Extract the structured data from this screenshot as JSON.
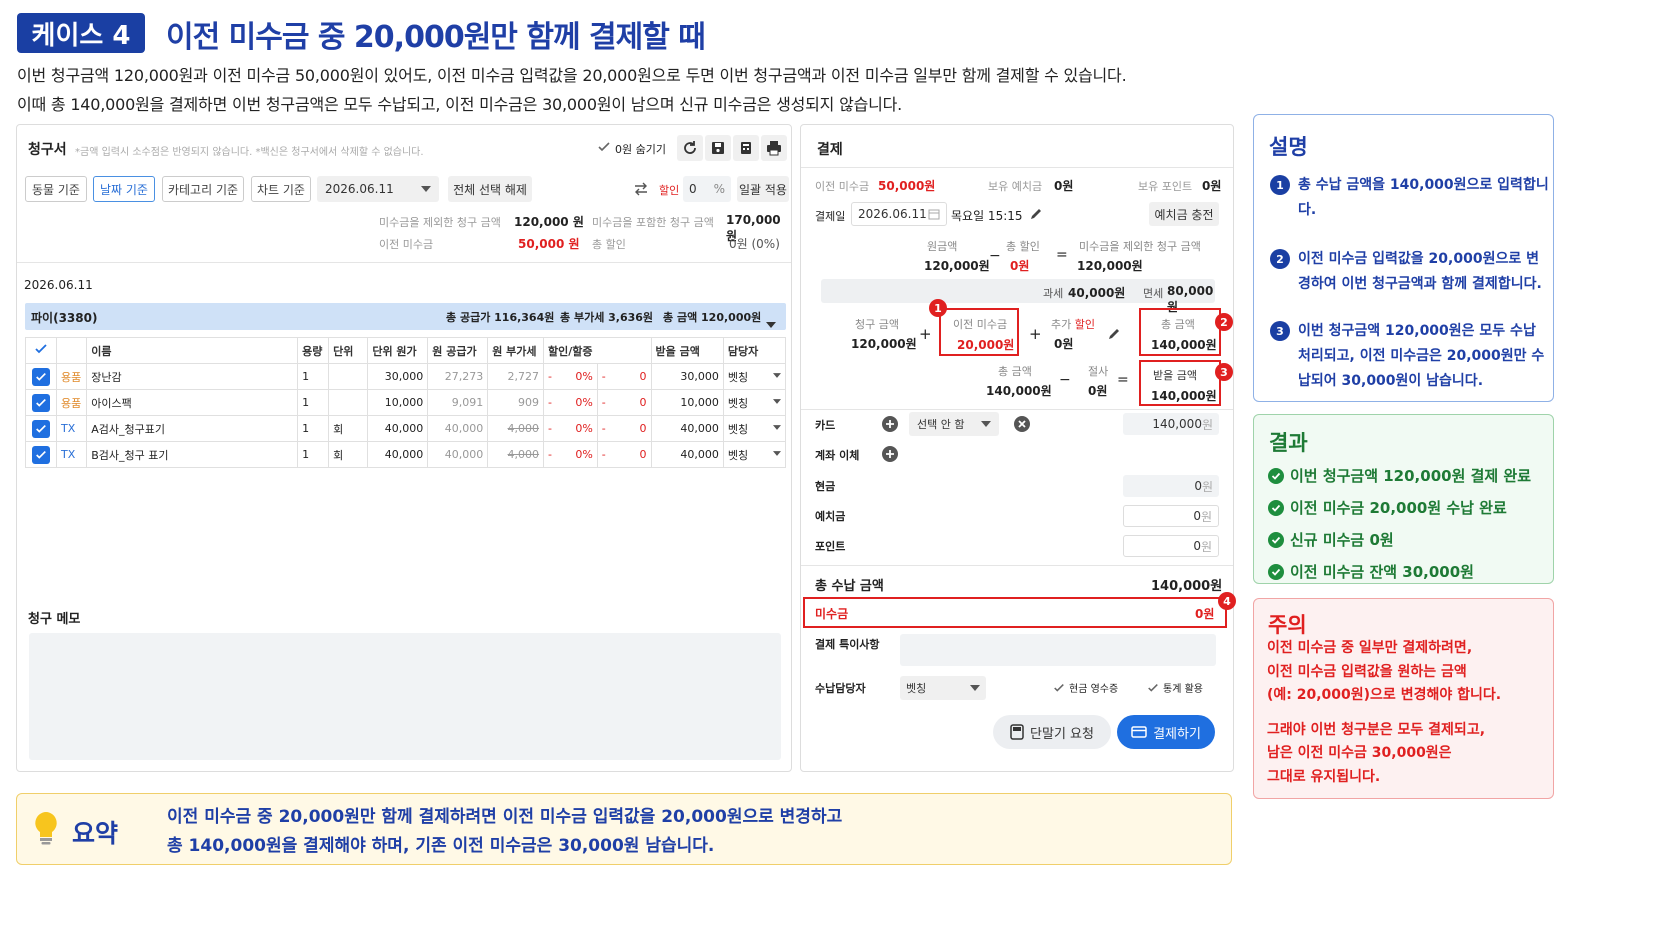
{
  "header": {
    "badge": "케이스 4",
    "title": "이전 미수금 중 20,000원만 함께 결제할 때",
    "line1": "이번 청구금액 120,000원과 이전 미수금 50,000원이 있어도, 이전 미수금 입력값을 20,000원으로 두면 이번 청구금액과 이전 미수금 일부만 함께 결제할 수 있습니다.",
    "line2": "이때 총 140,000원을 결제하면 이번 청구금액은 모두 수납되고, 이전 미수금은 30,000원이 남으며 신규 미수금은 생성되지 않습니다."
  },
  "invoice": {
    "title": "청구서",
    "note": "*금액 입력시 소수점은 반영되지 않습니다. *백신은 청구서에서 삭제할 수 없습니다.",
    "hide_zero": "0원 숨기기",
    "filters": [
      "동물 기준",
      "날짜 기준",
      "카테고리 기준",
      "차트 기준"
    ],
    "date": "2026.06.11",
    "deselect_all": "전체 선택 해제",
    "discount_label": "할인",
    "discount_value": "0",
    "discount_unit": "%",
    "apply_all": "일괄 적용",
    "excl_label": "미수금을 제외한 청구 금액",
    "excl_value": "120,000 원",
    "incl_label": "미수금을 포함한 청구 금액",
    "incl_value": "170,000원",
    "prev_label": "이전 미수금",
    "prev_value": "50,000 원",
    "totdisc_label": "총 할인",
    "totdisc_value": "0원 (0%)",
    "group_date": "2026.06.11",
    "group_name": "파이(3380)",
    "group_supply": "총 공급가 116,364원",
    "group_vat": "총 부가세 3,636원",
    "group_total": "총 금액 120,000원",
    "columns": [
      "이름",
      "용량",
      "단위",
      "단위 원가",
      "원 공급가",
      "원 부가세",
      "할인/할증",
      "받을 금액",
      "담당자"
    ],
    "rows": [
      {
        "type": "용품",
        "name": "장난감",
        "qty": "1",
        "unit": "",
        "cost": "30,000",
        "supply": "27,273",
        "vat": "2,727",
        "dash1": "-",
        "pct": "0%",
        "dash2": "-",
        "disc": "0",
        "amount": "30,000",
        "staff": "벳칭"
      },
      {
        "type": "용품",
        "name": "아이스팩",
        "qty": "1",
        "unit": "",
        "cost": "10,000",
        "supply": "9,091",
        "vat": "909",
        "dash1": "-",
        "pct": "0%",
        "dash2": "-",
        "disc": "0",
        "amount": "10,000",
        "staff": "벳칭"
      },
      {
        "type": "TX",
        "name": "A검사_청구표기",
        "qty": "1",
        "unit": "회",
        "cost": "40,000",
        "supply": "40,000",
        "vat": "4,000",
        "dash1": "-",
        "pct": "0%",
        "dash2": "-",
        "disc": "0",
        "amount": "40,000",
        "staff": "벳칭"
      },
      {
        "type": "TX",
        "name": "B검사_청구 표기",
        "qty": "1",
        "unit": "회",
        "cost": "40,000",
        "supply": "40,000",
        "vat": "4,000",
        "dash1": "-",
        "pct": "0%",
        "dash2": "-",
        "disc": "0",
        "amount": "40,000",
        "staff": "벳칭"
      }
    ],
    "memo_label": "청구 메모"
  },
  "payment": {
    "title": "결제",
    "prev_label": "이전 미수금",
    "prev_value": "50,000원",
    "deposit_label": "보유 예치금",
    "deposit_value": "0원",
    "points_label": "보유 포인트",
    "points_value": "0원",
    "date_label": "결제일",
    "date_value": "2026.06.11",
    "time_value": "목요일 15:15",
    "charge_btn": "예치금 충전",
    "base_label": "원금액",
    "base_value": "120,000원",
    "disc_label": "총 할인",
    "disc_value": "0원",
    "excl_label": "미수금을 제외한 청구 금액",
    "excl_value": "120,000원",
    "tax_label": "과세",
    "tax_value": "40,000원",
    "free_label": "면세",
    "free_value": "80,000원",
    "bill_label": "청구 금액",
    "bill_value": "120,000원",
    "prev2_label": "이전 미수금",
    "prev2_value": "20,000원",
    "extra_label": "추가",
    "extra_red": "할인",
    "extra_value": "0원",
    "total_label": "총 금액",
    "total_value": "140,000원",
    "total2_label": "총 금액",
    "total2_value": "140,000원",
    "cut_label": "절사",
    "cut_value": "0원",
    "receive_label": "받을 금액",
    "receive_value": "140,000원",
    "card_label": "카드",
    "card_select": "선택 안 함",
    "card_value": "140,000",
    "won": "원",
    "transfer_label": "계좌 이체",
    "cash_label": "현금",
    "cash_value": "0",
    "dep_label": "예치금",
    "dep_value": "0",
    "pt_label": "포인트",
    "pt_value": "0",
    "sum_label": "총 수납 금액",
    "sum_value": "140,000원",
    "unpaid_label": "미수금",
    "unpaid_value": "0원",
    "special_label": "결제 특이사항",
    "staff_label": "수납담당자",
    "staff_value": "벳칭",
    "cash_receipt": "현금 영수증",
    "stats": "통계 활용",
    "terminal_btn": "단말기 요청",
    "pay_btn": "결제하기"
  },
  "markers": [
    "1",
    "2",
    "3",
    "4"
  ],
  "explain": {
    "title": "설명",
    "items": [
      {
        "n": "1",
        "text": "총 수납 금액을 140,000원으로 입력합니다."
      },
      {
        "n": "2",
        "text": "이전 미수금 입력값을 20,000원으로 변경하여 이번 청구금액과 함께 결제합니다."
      },
      {
        "n": "3",
        "text": "이번 청구금액 120,000원은 모두 수납 처리되고, 이전 미수금은 20,000원만 수납되어 30,000원이 남습니다."
      }
    ]
  },
  "result": {
    "title": "결과",
    "items": [
      "이번 청구금액 120,000원 결제 완료",
      "이전 미수금 20,000원 수납 완료",
      "신규 미수금 0원",
      "이전 미수금 잔액 30,000원"
    ]
  },
  "caution": {
    "title": "주의",
    "p1": [
      "이전 미수금 중 일부만 결제하려면,",
      "이전 미수금 입력값을 원하는 금액",
      "(예: 20,000원)으로 변경해야 합니다."
    ],
    "p2": [
      "그래야 이번 청구분은 모두 결제되고,",
      "남은 이전 미수금 30,000원은",
      "그대로 유지됩니다."
    ]
  },
  "summary": {
    "title": "요약",
    "line1": "이전 미수금 중 20,000원만 함께 결제하려면 이전 미수금 입력값을 20,000원으로 변경하고",
    "line2": "총 140,000원을 결제해야 하며, 기존 이전 미수금은 30,000원 남습니다."
  },
  "colors": {
    "accent": "#1a3fa3",
    "red": "#e02020",
    "green": "#1e8e3e",
    "blue": "#1f6fe0"
  }
}
